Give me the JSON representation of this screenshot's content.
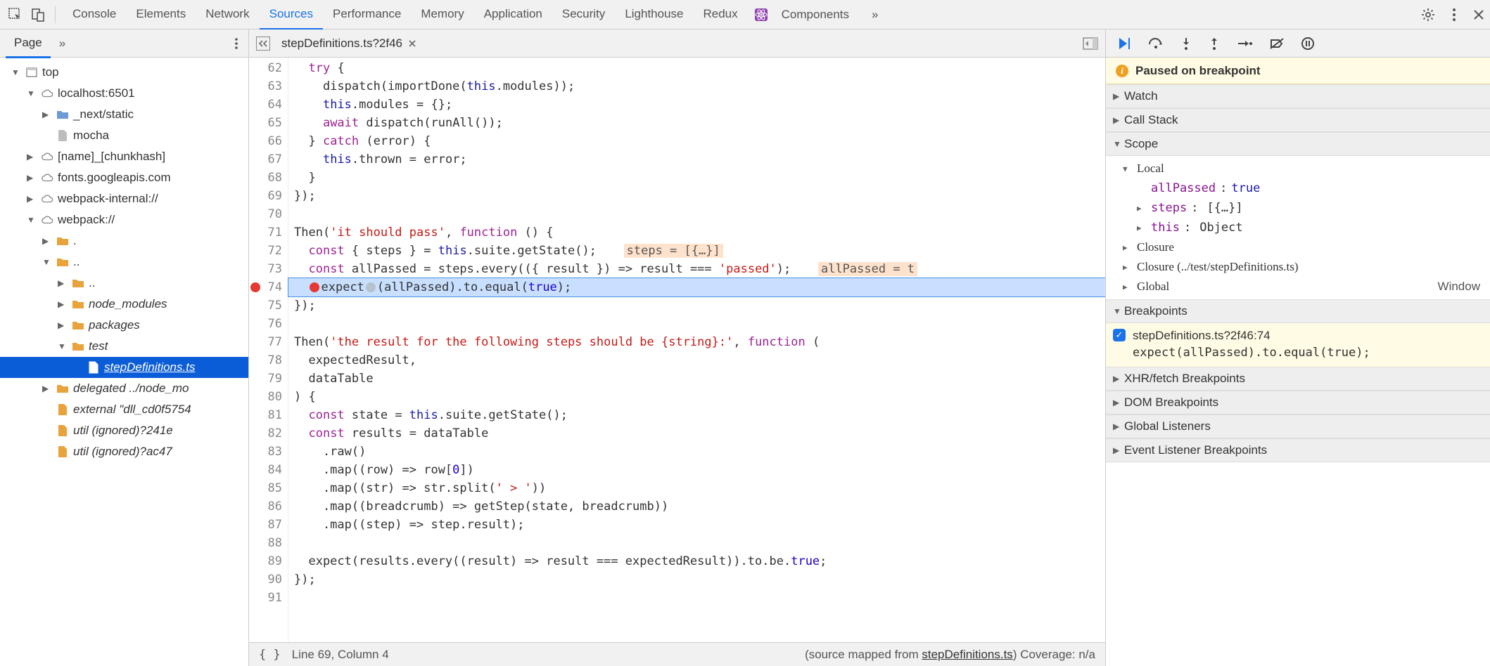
{
  "top_tabs": {
    "items": [
      "Console",
      "Elements",
      "Network",
      "Sources",
      "Performance",
      "Memory",
      "Application",
      "Security",
      "Lighthouse",
      "Redux",
      "Components"
    ],
    "active_index": 3
  },
  "left": {
    "subtabs": {
      "items": [
        "Page"
      ],
      "overflow": "»",
      "active_index": 0
    },
    "tree": [
      {
        "depth": 0,
        "exp": "▼",
        "icon": "frame",
        "label": "top"
      },
      {
        "depth": 1,
        "exp": "▼",
        "icon": "cloud",
        "label": "localhost:6501"
      },
      {
        "depth": 2,
        "exp": "▶",
        "icon": "folder-blue",
        "label": "_next/static"
      },
      {
        "depth": 2,
        "exp": "",
        "icon": "file-grey",
        "label": "mocha"
      },
      {
        "depth": 1,
        "exp": "▶",
        "icon": "cloud",
        "label": "[name]_[chunkhash]"
      },
      {
        "depth": 1,
        "exp": "▶",
        "icon": "cloud",
        "label": "fonts.googleapis.com"
      },
      {
        "depth": 1,
        "exp": "▶",
        "icon": "cloud",
        "label": "webpack-internal://"
      },
      {
        "depth": 1,
        "exp": "▼",
        "icon": "cloud",
        "label": "webpack://"
      },
      {
        "depth": 2,
        "exp": "▶",
        "icon": "folder-orange",
        "label": "."
      },
      {
        "depth": 2,
        "exp": "▼",
        "icon": "folder-orange",
        "label": ".."
      },
      {
        "depth": 3,
        "exp": "▶",
        "icon": "folder-orange",
        "label": ".."
      },
      {
        "depth": 3,
        "exp": "▶",
        "icon": "folder-orange",
        "label": "node_modules",
        "italic": true
      },
      {
        "depth": 3,
        "exp": "▶",
        "icon": "folder-orange",
        "label": "packages",
        "italic": true
      },
      {
        "depth": 3,
        "exp": "▼",
        "icon": "folder-orange",
        "label": "test",
        "italic": true
      },
      {
        "depth": 4,
        "exp": "",
        "icon": "file-white",
        "label": "stepDefinitions.ts",
        "italic": true,
        "selected": true
      },
      {
        "depth": 2,
        "exp": "▶",
        "icon": "folder-orange",
        "label": "delegated ../node_mo",
        "italic": true
      },
      {
        "depth": 2,
        "exp": "",
        "icon": "file-orange",
        "label": "external \"dll_cd0f5754",
        "italic": true
      },
      {
        "depth": 2,
        "exp": "",
        "icon": "file-orange",
        "label": "util (ignored)?241e",
        "italic": true
      },
      {
        "depth": 2,
        "exp": "",
        "icon": "file-orange",
        "label": "util (ignored)?ac47",
        "italic": true
      }
    ]
  },
  "editor": {
    "file_tab": "stepDefinitions.ts?2f46",
    "first_line": 62,
    "current_line": 74,
    "breakpoint_lines": [
      74
    ],
    "lines": [
      {
        "n": 62,
        "html": "  <span class='tok-kw'>try</span> {"
      },
      {
        "n": 63,
        "html": "    dispatch(importDone(<span class='tok-this'>this</span>.modules));"
      },
      {
        "n": 64,
        "html": "    <span class='tok-this'>this</span>.modules = {};"
      },
      {
        "n": 65,
        "html": "    <span class='tok-kw'>await</span> dispatch(runAll());"
      },
      {
        "n": 66,
        "html": "  } <span class='tok-kw'>catch</span> (error) {"
      },
      {
        "n": 67,
        "html": "    <span class='tok-this'>this</span>.thrown = error;"
      },
      {
        "n": 68,
        "html": "  }"
      },
      {
        "n": 69,
        "html": "});"
      },
      {
        "n": 70,
        "html": ""
      },
      {
        "n": 71,
        "html": "Then(<span class='tok-str'>'it should pass'</span>, <span class='tok-kw'>function</span> () {"
      },
      {
        "n": 72,
        "html": "  <span class='tok-kw'>const</span> { steps } = <span class='tok-this'>this</span>.suite.getState();   <span class='hint'>steps = [{…}]</span>"
      },
      {
        "n": 73,
        "html": "  <span class='tok-kw'>const</span> allPassed = steps.every(({ result }) =&gt; result === <span class='tok-str'>'passed'</span>);   <span class='hint'>allPassed = t</span>"
      },
      {
        "n": 74,
        "html": "  <span class='inline-bp'></span>expect<span class='inline-bp gray'></span>(allPassed).to.equal(<span class='tok-num'>true</span>);"
      },
      {
        "n": 75,
        "html": "});"
      },
      {
        "n": 76,
        "html": ""
      },
      {
        "n": 77,
        "html": "Then(<span class='tok-str'>'the result for the following steps should be {string}:'</span>, <span class='tok-kw'>function</span> ("
      },
      {
        "n": 78,
        "html": "  expectedResult,"
      },
      {
        "n": 79,
        "html": "  dataTable"
      },
      {
        "n": 80,
        "html": ") {"
      },
      {
        "n": 81,
        "html": "  <span class='tok-kw'>const</span> state = <span class='tok-this'>this</span>.suite.getState();"
      },
      {
        "n": 82,
        "html": "  <span class='tok-kw'>const</span> results = dataTable"
      },
      {
        "n": 83,
        "html": "    .raw()"
      },
      {
        "n": 84,
        "html": "    .map((row) =&gt; row[<span class='tok-num'>0</span>])"
      },
      {
        "n": 85,
        "html": "    .map((str) =&gt; str.split(<span class='tok-str'>' &gt; '</span>))"
      },
      {
        "n": 86,
        "html": "    .map((breadcrumb) =&gt; getStep(state, breadcrumb))"
      },
      {
        "n": 87,
        "html": "    .map((step) =&gt; step.result);"
      },
      {
        "n": 88,
        "html": ""
      },
      {
        "n": 89,
        "html": "  expect(results.every((result) =&gt; result === expectedResult)).to.be.<span class='tok-num'>true</span>;"
      },
      {
        "n": 90,
        "html": "});"
      },
      {
        "n": 91,
        "html": ""
      }
    ],
    "status": {
      "cursor": "Line 69, Column 4",
      "mapped_prefix": "(source mapped from ",
      "mapped_file": "stepDefinitions.ts",
      "mapped_suffix": ") Coverage: n/a"
    }
  },
  "debugger": {
    "paused_banner": "Paused on breakpoint",
    "sections": {
      "watch": "Watch",
      "callstack": "Call Stack",
      "scope": "Scope",
      "breakpoints": "Breakpoints",
      "xhr": "XHR/fetch Breakpoints",
      "dom": "DOM Breakpoints",
      "global_listeners": "Global Listeners",
      "event_listener": "Event Listener Breakpoints"
    },
    "scope": {
      "local_label": "Local",
      "vars": [
        {
          "exp": "",
          "name": "allPassed",
          "value": "true",
          "valclass": "scope-val"
        },
        {
          "exp": "▶",
          "name": "steps",
          "value": "[{…}]",
          "valclass": "scope-obj"
        },
        {
          "exp": "▶",
          "name": "this",
          "value": "Object",
          "valclass": "scope-obj"
        }
      ],
      "closures": [
        {
          "exp": "▶",
          "label": "Closure"
        },
        {
          "exp": "▶",
          "label": "Closure (../test/stepDefinitions.ts)"
        }
      ],
      "global": {
        "exp": "▶",
        "label": "Global",
        "right": "Window"
      }
    },
    "breakpoints": [
      {
        "checked": true,
        "location": "stepDefinitions.ts?2f46:74",
        "code": "expect(allPassed).to.equal(true);"
      }
    ]
  }
}
